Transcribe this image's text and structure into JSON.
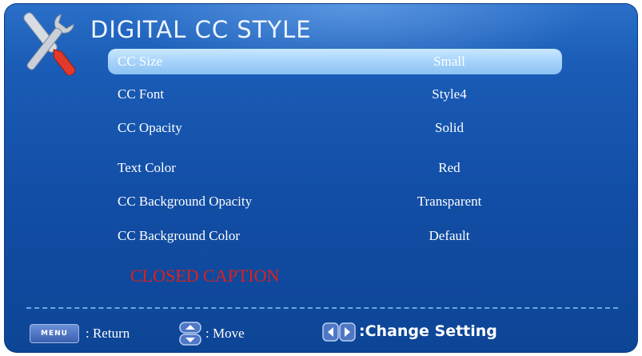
{
  "header": {
    "title": "DIGITAL CC STYLE",
    "icon": "wrench-screwdriver-icon"
  },
  "menu": {
    "items": [
      {
        "label": "CC Size",
        "value": "Small",
        "selected": true
      },
      {
        "label": "CC Font",
        "value": "Style4",
        "selected": false
      },
      {
        "label": "CC Opacity",
        "value": "Solid",
        "selected": false
      },
      {
        "label": "Text Color",
        "value": "Red",
        "selected": false
      },
      {
        "label": "CC Background Opacity",
        "value": "Transparent",
        "selected": false
      },
      {
        "label": "CC Background Color",
        "value": "Default",
        "selected": false
      }
    ]
  },
  "preview": {
    "text": "CLOSED CAPTION",
    "color": "#e0201a"
  },
  "footer": {
    "menu_key": "MENU",
    "return_label": ": Return",
    "move_label": ": Move",
    "change_label": ":Change Setting"
  },
  "colors": {
    "background": "#124ea6",
    "highlight": "#a7d3fb",
    "text": "#ffffff"
  }
}
